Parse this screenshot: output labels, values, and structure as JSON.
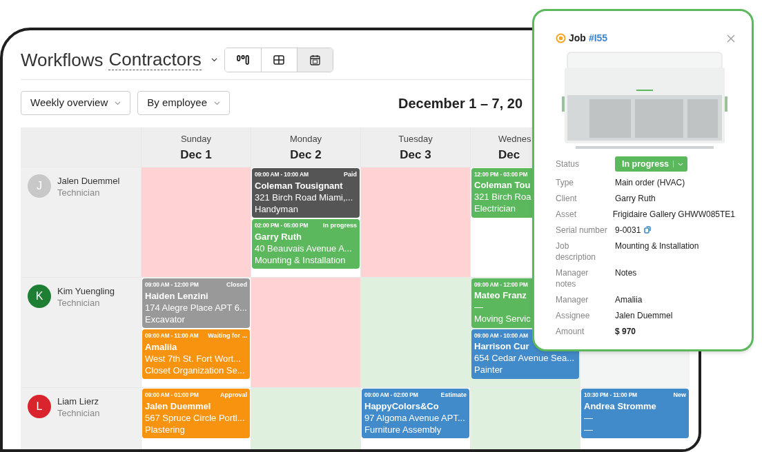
{
  "header": {
    "title": "Workflows",
    "workflow": "Contractors",
    "views": [
      {
        "kind": "board",
        "selected": false
      },
      {
        "kind": "table",
        "selected": false
      },
      {
        "kind": "calendar",
        "selected": true
      }
    ]
  },
  "filters": [
    {
      "label": "Weekly overview"
    },
    {
      "label": "By employee"
    }
  ],
  "date_range": "December 1 – 7, 20",
  "days": [
    {
      "weekday": "Sunday",
      "date": "Dec 1"
    },
    {
      "weekday": "Monday",
      "date": "Dec 2"
    },
    {
      "weekday": "Tuesday",
      "date": "Dec 3"
    },
    {
      "weekday": "Wednes",
      "date": "Dec",
      "kind": "partial"
    }
  ],
  "employees": [
    {
      "initial": "J",
      "name": "Jalen Duemmel",
      "role": "Technician",
      "color": "#c8c8c8",
      "cells": [
        {
          "kind": "unavailable"
        },
        {
          "kind": "free",
          "events": [
            {
              "time": "09:00 AM - 10:00 AM",
              "status": "Paid",
              "name": "Coleman Tousignant",
              "address": "321 Birch Road Miami,...",
              "service": "Handyman",
              "color": "#555555"
            },
            {
              "time": "02:00 PM - 05:00 PM",
              "status": "In progress",
              "name": "Garry Ruth",
              "address": "40 Beauvais Avenue A...",
              "service": "Mounting & Installation",
              "color": "#5cb85c"
            }
          ]
        },
        {
          "kind": "unavailable"
        },
        {
          "kind": "free",
          "events": [
            {
              "time": "12:00 PM - 03:00 PM",
              "name": "Coleman Tou",
              "address": "321 Birch Roa",
              "service": "Electrician",
              "color": "#5cb85c"
            }
          ]
        }
      ]
    },
    {
      "initial": "K",
      "name": "Kim Yuengling",
      "role": "Technician",
      "color": "#1e7e34",
      "cells": [
        {
          "kind": "free",
          "events": [
            {
              "time": "09:00 AM - 12:00 PM",
              "status": "Closed",
              "name": "Haiden Lenzini",
              "address": "174 Alegre Place APT 6...",
              "service": "Excavator",
              "color": "#999999"
            },
            {
              "time": "09:00 AM - 11:00 AM",
              "status": "Waiting for ...",
              "name": "Amaliia",
              "address": "West 7th St. Fort Wort...",
              "service": "Closet Organization Se...",
              "color": "#f7930e"
            }
          ]
        },
        {
          "kind": "unavailable"
        },
        {
          "kind": "available"
        },
        {
          "kind": "available",
          "events": [
            {
              "time": "09:00 AM - 12:00 PM",
              "name": "Mateo Franz",
              "address": "—",
              "service": "Moving Servic",
              "color": "#5cb85c"
            },
            {
              "time": "09:00 AM - 10:00 AM",
              "name": "Harrison Cur",
              "address": "654 Cedar Avenue Sea...",
              "service": "Painter",
              "color": "#428bca"
            }
          ]
        },
        {
          "kind": "off"
        }
      ]
    },
    {
      "initial": "L",
      "name": "Liam Lierz",
      "role": "Technician",
      "color": "#d9232d",
      "cells": [
        {
          "kind": "free",
          "events": [
            {
              "time": "09:00 AM - 01:00 PM",
              "status": "Approval",
              "name": "Jalen Duemmel",
              "address": "567 Spruce Circle Portl...",
              "service": "Plastering",
              "color": "#f7930e"
            }
          ]
        },
        {
          "kind": "available"
        },
        {
          "kind": "free",
          "events": [
            {
              "time": "09:00 AM - 02:00 PM",
              "status": "Estimate",
              "name": "HappyColors&Co",
              "address": "97 Algoma Avenue APT...",
              "service": "Furniture Assembly",
              "color": "#428bca"
            }
          ]
        },
        {
          "kind": "available"
        },
        {
          "kind": "free",
          "events": [
            {
              "time": "10:30 PM - 11:00 PM",
              "status": "New",
              "name": "Andrea Stromme",
              "address": "—",
              "service": "—",
              "color": "#428bca"
            }
          ]
        }
      ]
    }
  ],
  "job_popup": {
    "label": "Job",
    "number": "#I55",
    "status": {
      "label": "Status",
      "value": "In progress"
    },
    "fields": [
      {
        "label": "Type",
        "value": "Main order (HVAC)"
      },
      {
        "label": "Client",
        "value": "Garry Ruth"
      },
      {
        "label": "Asset",
        "value": "Frigidaire Gallery GHWW085TE1"
      },
      {
        "label": "Serial number",
        "value": "9-0031",
        "kind": "copy"
      },
      {
        "label": "Job description",
        "value": "Mounting & Installation"
      },
      {
        "label": "Manager notes",
        "value": "Notes"
      },
      {
        "label": "Manager",
        "value": "Amaliia"
      },
      {
        "label": "Assignee",
        "value": "Jalen Duemmel"
      },
      {
        "label": "Amount",
        "value": "$ 970",
        "kind": "bold"
      }
    ]
  }
}
